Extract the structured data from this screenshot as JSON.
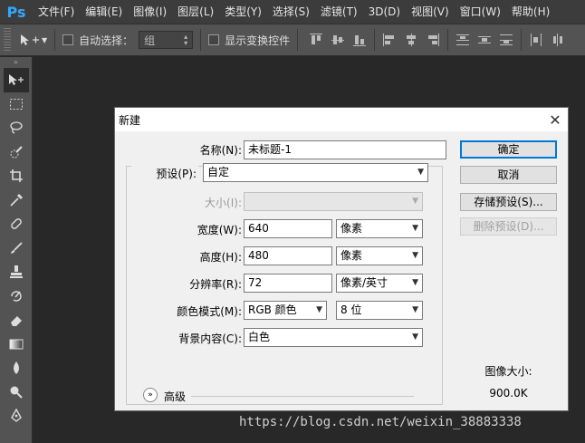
{
  "app": {
    "logo": "Ps"
  },
  "menu": [
    "文件(F)",
    "编辑(E)",
    "图像(I)",
    "图层(L)",
    "类型(Y)",
    "选择(S)",
    "滤镜(T)",
    "3D(D)",
    "视图(V)",
    "窗口(W)",
    "帮助(H)"
  ],
  "options_bar": {
    "auto_select_label": "自动选择：",
    "auto_select_value": "组",
    "show_transform_label": "显示变换控件"
  },
  "tools": [
    "move-tool",
    "marquee-tool",
    "lasso-tool",
    "quick-select-tool",
    "crop-tool",
    "eyedropper-tool",
    "healing-brush-tool",
    "brush-tool",
    "clone-stamp-tool",
    "history-brush-tool",
    "eraser-tool",
    "gradient-tool",
    "blur-tool",
    "dodge-tool",
    "pen-tool"
  ],
  "dialog": {
    "title": "新建",
    "name_label": "名称(N):",
    "name_value": "未标题-1",
    "preset_label": "预设(P):",
    "preset_value": "自定",
    "size_label": "大小(I):",
    "size_value": "",
    "width_label": "宽度(W):",
    "width_value": "640",
    "width_unit": "像素",
    "height_label": "高度(H):",
    "height_value": "480",
    "height_unit": "像素",
    "resolution_label": "分辨率(R):",
    "resolution_value": "72",
    "resolution_unit": "像素/英寸",
    "color_mode_label": "颜色模式(M):",
    "color_mode_value": "RGB 颜色",
    "bit_depth_value": "8 位",
    "bg_label": "背景内容(C):",
    "bg_value": "白色",
    "advanced_label": "高级",
    "ok_label": "确定",
    "cancel_label": "取消",
    "save_preset_label": "存储预设(S)...",
    "delete_preset_label": "删除预设(D)...",
    "image_size_label": "图像大小:",
    "image_size_value": "900.0K"
  },
  "watermark": "https://blog.csdn.net/weixin_38883338"
}
